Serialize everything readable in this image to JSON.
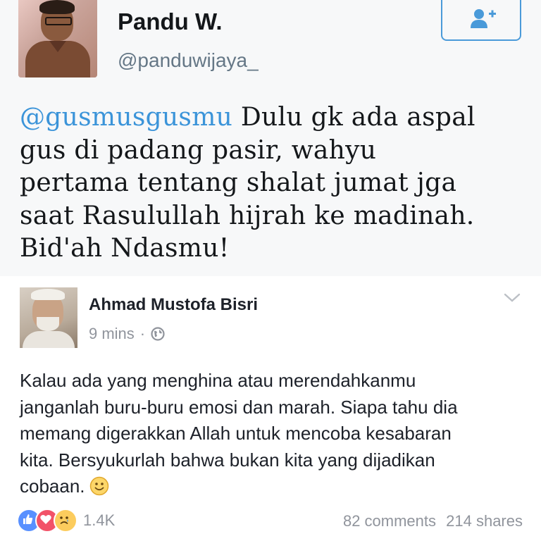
{
  "tweet": {
    "name": "Pandu W.",
    "handle": "@panduwijaya_",
    "follow_icon": "follow-user-plus-icon",
    "mention": "@gusmusgusmu",
    "lines": [
      " Dulu gk ada aspal",
      "gus di padang pasir, wahyu",
      "pertama tentang shalat jumat jga",
      "saat Rasulullah hijrah ke madinah.",
      "Bid'ah Ndasmu!"
    ],
    "colors": {
      "mention": "#3b94d9",
      "follow_border": "#4a9ad9"
    }
  },
  "post": {
    "author": "Ahmad Mustofa Bisri",
    "time": "9 mins",
    "separator": "·",
    "privacy_icon": "globe-icon",
    "options_icon": "chevron-down-icon",
    "lines": [
      "Kalau ada yang menghina atau merendahkanmu",
      "janganlah buru-buru emosi dan marah. Siapa tahu dia",
      "memang digerakkan Allah untuk mencoba kesabaran",
      "kita. Bersyukurlah bahwa bukan kita yang dijadikan",
      "cobaan."
    ],
    "emoji": "smiley-icon"
  },
  "footer": {
    "reactions": [
      "like-icon",
      "love-icon",
      "sad-icon"
    ],
    "reaction_count": "1.4K",
    "comments": "82 comments",
    "shares": "214 shares"
  }
}
